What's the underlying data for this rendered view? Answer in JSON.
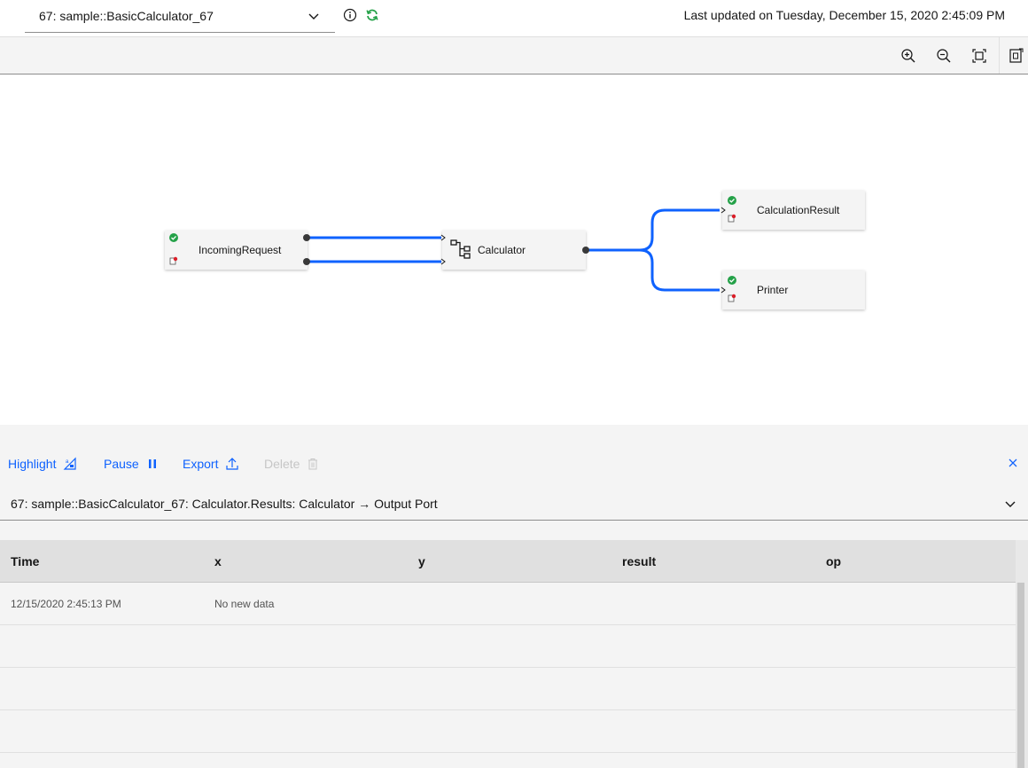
{
  "header": {
    "job_selector_value": "67: sample::BasicCalculator_67",
    "last_updated": "Last updated on Tuesday, December 15, 2020 2:45:09 PM",
    "icons": [
      "info-icon",
      "refresh-icon",
      "chevron-down-icon"
    ]
  },
  "toolbar": {
    "icons": [
      "zoom-in-icon",
      "zoom-out-icon",
      "fit-to-screen-icon",
      "export-image-icon"
    ]
  },
  "graph": {
    "nodes": [
      {
        "label": "IncomingRequest",
        "status": "healthy"
      },
      {
        "label": "Calculator",
        "status": "composite"
      },
      {
        "label": "CalculationResult",
        "status": "healthy"
      },
      {
        "label": "Printer",
        "status": "healthy"
      }
    ],
    "connection_color": "#0f62fe"
  },
  "panel": {
    "actions": {
      "highlight": "Highlight",
      "pause": "Pause",
      "export": "Export",
      "delete": "Delete"
    },
    "stream_selector": "67: sample::BasicCalculator_67: Calculator.Results: Calculator → Output Port",
    "table": {
      "columns": [
        "Time",
        "x",
        "y",
        "result",
        "op"
      ],
      "rows": [
        [
          "12/15/2020 2:45:13 PM",
          "No new data",
          "",
          "",
          ""
        ],
        [
          "",
          "",
          "",
          "",
          ""
        ],
        [
          "",
          "",
          "",
          "",
          ""
        ],
        [
          "",
          "",
          "",
          "",
          ""
        ]
      ]
    }
  },
  "colors": {
    "accent": "#0f62fe",
    "success": "#24a148",
    "error": "#da1e28",
    "refresh": "#24a148"
  }
}
